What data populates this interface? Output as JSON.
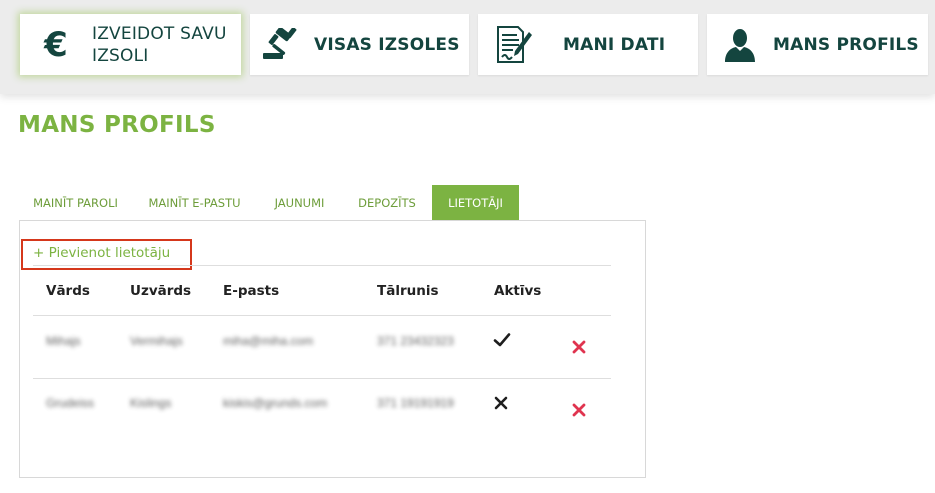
{
  "nav": {
    "create_auction": {
      "label": "IZVEIDOT SAVU IZSOLI",
      "icon": "euro-icon"
    },
    "all_auctions": {
      "label": "VISAS IZSOLES",
      "icon": "gavel-icon"
    },
    "my_data": {
      "label": "MANI DATI",
      "icon": "document-icon"
    },
    "my_profile": {
      "label": "MANS PROFILS",
      "icon": "user-icon"
    }
  },
  "page": {
    "title": "MANS PROFILS"
  },
  "tabs": [
    {
      "label": "MAINĪT PAROLI",
      "active": false
    },
    {
      "label": "MAINĪT E-PASTU",
      "active": false
    },
    {
      "label": "JAUNUMI",
      "active": false
    },
    {
      "label": "DEPOZĪTS",
      "active": false
    },
    {
      "label": "LIETOTĀJI",
      "active": true
    }
  ],
  "users": {
    "add_label": "+ Pievienot lietotāju",
    "columns": [
      "Vārds",
      "Uzvārds",
      "E-pasts",
      "Tālrunis",
      "Aktīvs"
    ],
    "rows": [
      {
        "first_name": "Mihajs",
        "last_name": "Vermihajs",
        "email": "miha@miha.com",
        "phone": "371 23432323",
        "active": true
      },
      {
        "first_name": "Grudeiss",
        "last_name": "Kislings",
        "email": "kiskis@grunds.com",
        "phone": "371 19191919",
        "active": false
      }
    ]
  },
  "colors": {
    "accent": "#7cb342",
    "nav_text": "#14453f",
    "delete": "#e0344f",
    "highlight": "#d5371b"
  }
}
